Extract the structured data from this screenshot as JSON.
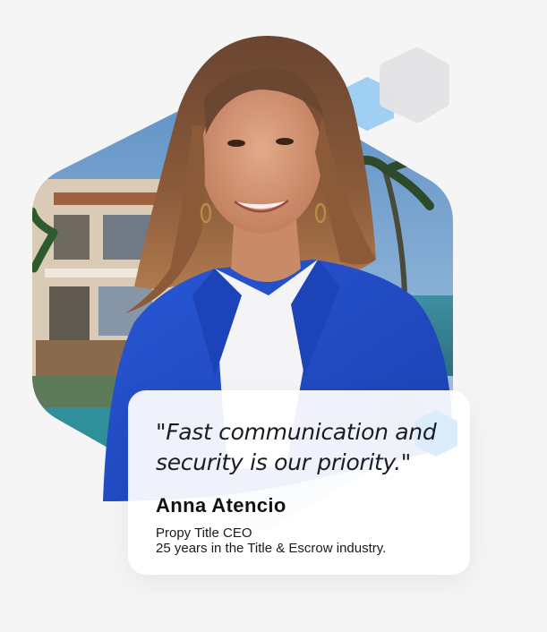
{
  "testimonial": {
    "quote": "\"Fast communication and security is our priority.\"",
    "name": "Anna Atencio",
    "role": "Propy Title CEO",
    "experience": "25 years in the Title & Escrow industry."
  },
  "colors": {
    "page_background": "#f5f5f6",
    "accent_blue": "#7fbff2",
    "blazer_blue": "#1f4bc4",
    "deco_grey": "#e6e6e8"
  },
  "icons": [
    "hexagon-decoration",
    "portrait-photo"
  ]
}
